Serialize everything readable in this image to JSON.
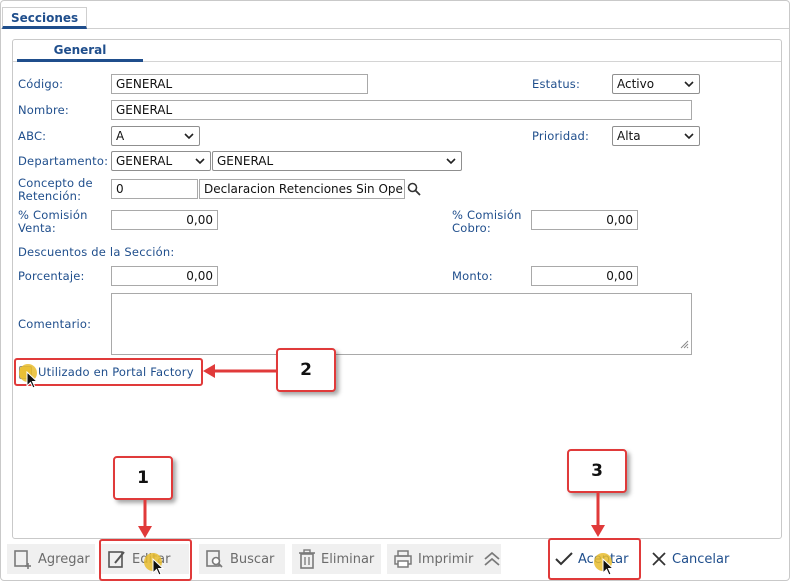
{
  "tabs": {
    "main": "Secciones"
  },
  "subtabs": {
    "general": "General"
  },
  "form": {
    "codigo": {
      "label": "Código:",
      "value": "GENERAL"
    },
    "estatus": {
      "label": "Estatus:",
      "value": "Activo"
    },
    "nombre": {
      "label": "Nombre:",
      "value": "GENERAL"
    },
    "abc": {
      "label": "ABC:",
      "value": "A"
    },
    "prioridad": {
      "label": "Prioridad:",
      "value": "Alta"
    },
    "departamento": {
      "label": "Departamento:",
      "code": "GENERAL",
      "value": "GENERAL"
    },
    "concepto": {
      "label_line1": "Concepto de",
      "label_line2": "Retención:",
      "code": "0",
      "value": "Declaracion Retenciones Sin Ope"
    },
    "comision_venta": {
      "label_line1": "% Comisión",
      "label_line2": "Venta:",
      "value": "0,00"
    },
    "comision_cobro": {
      "label_line1": "% Comisión",
      "label_line2": "Cobro:",
      "value": "0,00"
    },
    "descuentos_title": "Descuentos de la Sección:",
    "porcentaje": {
      "label": "Porcentaje:",
      "value": "0,00"
    },
    "monto": {
      "label": "Monto:",
      "value": "0,00"
    },
    "comentario": {
      "label": "Comentario:",
      "value": ""
    },
    "portal": {
      "label": "Utilizado en Portal Factory",
      "checked": true
    }
  },
  "toolbar": {
    "agregar": "Agregar",
    "editar": "Editar",
    "buscar": "Buscar",
    "eliminar": "Eliminar",
    "imprimir": "Imprimir",
    "aceptar": "Aceptar",
    "cancelar": "Cancelar"
  },
  "callouts": {
    "one": "1",
    "two": "2",
    "three": "3"
  },
  "colors": {
    "accent": "#1f4e8c",
    "callout": "#e03a3a",
    "cursor_highlight": "#e8bc2d"
  },
  "icons": [
    "chevron-down-icon",
    "search-icon",
    "resize-grip-icon",
    "checkbox-icon",
    "add-document-icon",
    "edit-document-icon",
    "search-document-icon",
    "trash-icon",
    "printer-icon",
    "double-chevron-up-icon",
    "checkmark-icon",
    "close-icon",
    "mouse-cursor-icon"
  ]
}
